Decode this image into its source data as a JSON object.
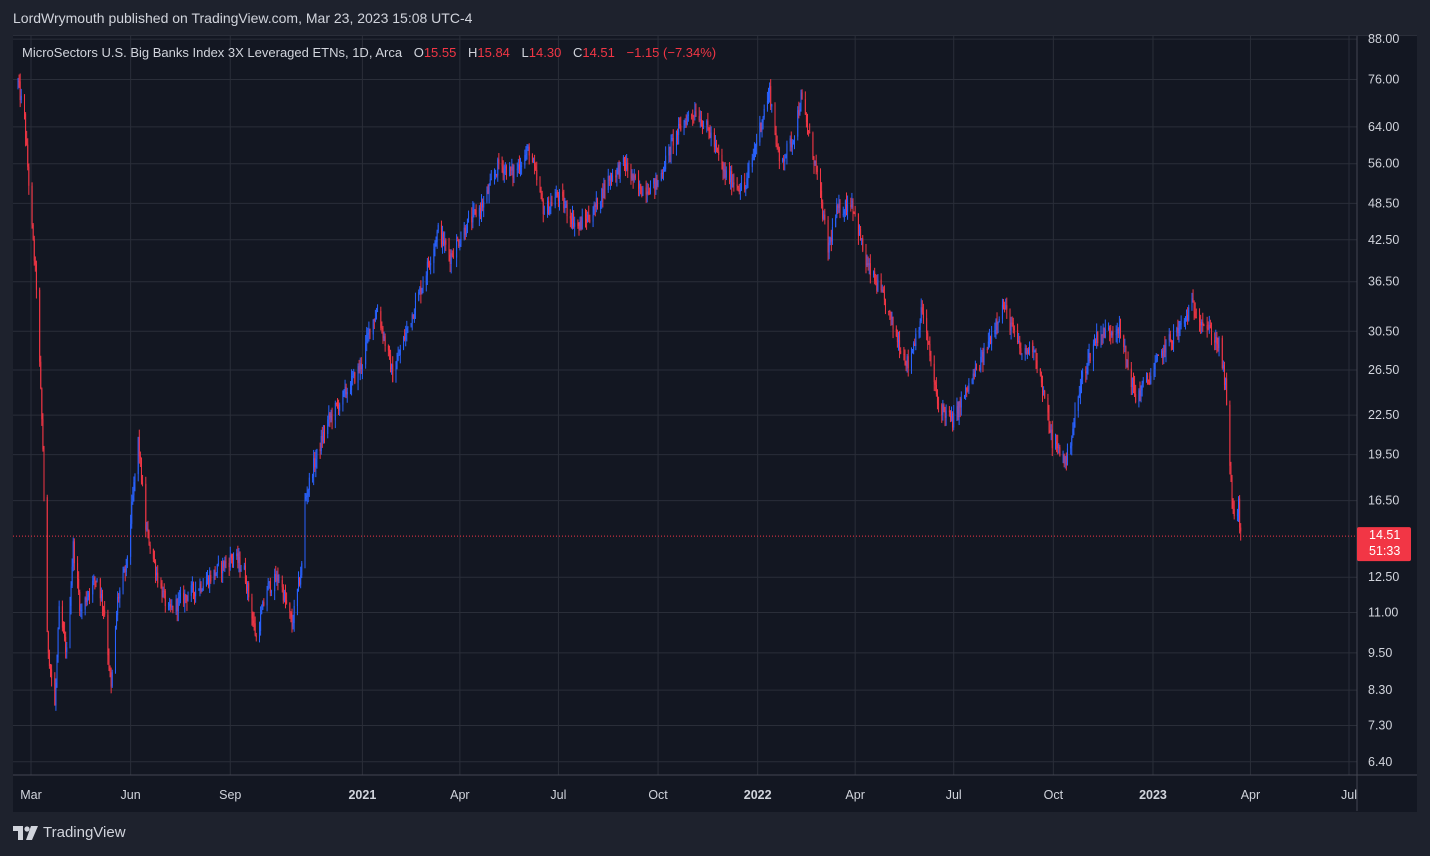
{
  "header": {
    "publisher_line": "LordWrymouth published on TradingView.com, Mar 23, 2023 15:08 UTC-4"
  },
  "legend": {
    "title": "MicroSectors U.S. Big Banks Index 3X Leveraged ETNs, 1D, Arca",
    "o_label": "O",
    "o_value": "15.55",
    "h_label": "H",
    "h_value": "15.84",
    "l_label": "L",
    "l_value": "14.30",
    "c_label": "C",
    "c_value": "14.51",
    "change": "−1.15 (−7.34%)"
  },
  "price_tag": {
    "price": "14.51",
    "countdown": "51:33"
  },
  "footer": {
    "brand": "TradingView",
    "logo_icon": "tradingview-logo-icon"
  },
  "colors": {
    "up": "#2962ff",
    "down": "#f23645",
    "background": "#131722",
    "grid": "#2a2e39"
  },
  "chart_data": {
    "type": "candlestick",
    "title": "MicroSectors U.S. Big Banks Index 3X Leveraged ETNs, 1D, Arca",
    "y_scale": "log",
    "ylim": [
      6.1,
      89
    ],
    "y_ticks": [
      "88.00",
      "76.00",
      "64.00",
      "56.00",
      "48.50",
      "42.50",
      "36.50",
      "30.50",
      "26.50",
      "22.50",
      "19.50",
      "16.50",
      "12.50",
      "11.00",
      "9.50",
      "8.30",
      "7.30",
      "6.40"
    ],
    "x_ticks": [
      {
        "date": "2020-03-01",
        "label": "Mar",
        "bold": false
      },
      {
        "date": "2020-06-01",
        "label": "Jun",
        "bold": false
      },
      {
        "date": "2020-09-01",
        "label": "Sep",
        "bold": false
      },
      {
        "date": "2021-01-01",
        "label": "2021",
        "bold": true
      },
      {
        "date": "2021-04-01",
        "label": "Apr",
        "bold": false
      },
      {
        "date": "2021-07-01",
        "label": "Jul",
        "bold": false
      },
      {
        "date": "2021-10-01",
        "label": "Oct",
        "bold": false
      },
      {
        "date": "2022-01-01",
        "label": "2022",
        "bold": true
      },
      {
        "date": "2022-04-01",
        "label": "Apr",
        "bold": false
      },
      {
        "date": "2022-07-01",
        "label": "Jul",
        "bold": false
      },
      {
        "date": "2022-10-01",
        "label": "Oct",
        "bold": false
      },
      {
        "date": "2023-01-01",
        "label": "2023",
        "bold": true
      },
      {
        "date": "2023-04-01",
        "label": "Apr",
        "bold": false
      },
      {
        "date": "2023-07-01",
        "label": "Jul",
        "bold": false
      }
    ],
    "x_range": [
      "2020-02-17",
      "2023-07-01"
    ],
    "last_close": 14.51,
    "close_series": [
      [
        "2020-02-18",
        75
      ],
      [
        "2020-02-24",
        66
      ],
      [
        "2020-03-02",
        44
      ],
      [
        "2020-03-06",
        36
      ],
      [
        "2020-03-12",
        20
      ],
      [
        "2020-03-16",
        10
      ],
      [
        "2020-03-23",
        7.8
      ],
      [
        "2020-03-27",
        11
      ],
      [
        "2020-04-03",
        9.5
      ],
      [
        "2020-04-09",
        14
      ],
      [
        "2020-04-16",
        11
      ],
      [
        "2020-04-24",
        12
      ],
      [
        "2020-05-01",
        12.5
      ],
      [
        "2020-05-08",
        11
      ],
      [
        "2020-05-14",
        8.3
      ],
      [
        "2020-05-20",
        11.5
      ],
      [
        "2020-05-28",
        13
      ],
      [
        "2020-06-08",
        20.5
      ],
      [
        "2020-06-15",
        15
      ],
      [
        "2020-06-26",
        12.5
      ],
      [
        "2020-07-06",
        11
      ],
      [
        "2020-07-17",
        11.5
      ],
      [
        "2020-07-31",
        12
      ],
      [
        "2020-08-14",
        12.5
      ],
      [
        "2020-08-24",
        13
      ],
      [
        "2020-09-04",
        13.5
      ],
      [
        "2020-09-14",
        12.8
      ],
      [
        "2020-09-25",
        10
      ],
      [
        "2020-10-05",
        12
      ],
      [
        "2020-10-16",
        12.5
      ],
      [
        "2020-10-28",
        10.5
      ],
      [
        "2020-11-06",
        13
      ],
      [
        "2020-11-09",
        16.5
      ],
      [
        "2020-11-16",
        18.5
      ],
      [
        "2020-11-30",
        22
      ],
      [
        "2020-12-14",
        24
      ],
      [
        "2020-12-31",
        27
      ],
      [
        "2021-01-08",
        31
      ],
      [
        "2021-01-15",
        33
      ],
      [
        "2021-01-29",
        26
      ],
      [
        "2021-02-12",
        31
      ],
      [
        "2021-02-26",
        36.5
      ],
      [
        "2021-03-12",
        44
      ],
      [
        "2021-03-23",
        40
      ],
      [
        "2021-04-08",
        45
      ],
      [
        "2021-04-23",
        48.5
      ],
      [
        "2021-05-07",
        56
      ],
      [
        "2021-05-20",
        54
      ],
      [
        "2021-06-04",
        59
      ],
      [
        "2021-06-18",
        47
      ],
      [
        "2021-06-30",
        50
      ],
      [
        "2021-07-19",
        44.5
      ],
      [
        "2021-08-02",
        47
      ],
      [
        "2021-08-16",
        53
      ],
      [
        "2021-08-31",
        56
      ],
      [
        "2021-09-13",
        51
      ],
      [
        "2021-09-30",
        52
      ],
      [
        "2021-10-15",
        61
      ],
      [
        "2021-10-27",
        66
      ],
      [
        "2021-11-05",
        68
      ],
      [
        "2021-11-19",
        62
      ],
      [
        "2021-12-01",
        54
      ],
      [
        "2021-12-20",
        51
      ],
      [
        "2022-01-04",
        65
      ],
      [
        "2022-01-12",
        73
      ],
      [
        "2022-01-21",
        56
      ],
      [
        "2022-02-02",
        61
      ],
      [
        "2022-02-10",
        71
      ],
      [
        "2022-02-24",
        55
      ],
      [
        "2022-03-07",
        41
      ],
      [
        "2022-03-15",
        47
      ],
      [
        "2022-03-29",
        49
      ],
      [
        "2022-04-11",
        39
      ],
      [
        "2022-04-25",
        35
      ],
      [
        "2022-05-09",
        30
      ],
      [
        "2022-05-20",
        27
      ],
      [
        "2022-06-02",
        33
      ],
      [
        "2022-06-16",
        23.5
      ],
      [
        "2022-06-30",
        22
      ],
      [
        "2022-07-15",
        25
      ],
      [
        "2022-07-29",
        28
      ],
      [
        "2022-08-10",
        32
      ],
      [
        "2022-08-16",
        33.5
      ],
      [
        "2022-09-02",
        28
      ],
      [
        "2022-09-13",
        29
      ],
      [
        "2022-09-30",
        20.5
      ],
      [
        "2022-10-13",
        19
      ],
      [
        "2022-10-28",
        26
      ],
      [
        "2022-11-10",
        30
      ],
      [
        "2022-11-30",
        31
      ],
      [
        "2022-12-16",
        24
      ],
      [
        "2022-12-30",
        26
      ],
      [
        "2023-01-13",
        29
      ],
      [
        "2023-01-27",
        31
      ],
      [
        "2023-02-06",
        33.5
      ],
      [
        "2023-02-17",
        31.5
      ],
      [
        "2023-03-03",
        29
      ],
      [
        "2023-03-09",
        25
      ],
      [
        "2023-03-13",
        18.5
      ],
      [
        "2023-03-17",
        15.3
      ],
      [
        "2023-03-21",
        16.2
      ],
      [
        "2023-03-23",
        14.51
      ]
    ]
  }
}
